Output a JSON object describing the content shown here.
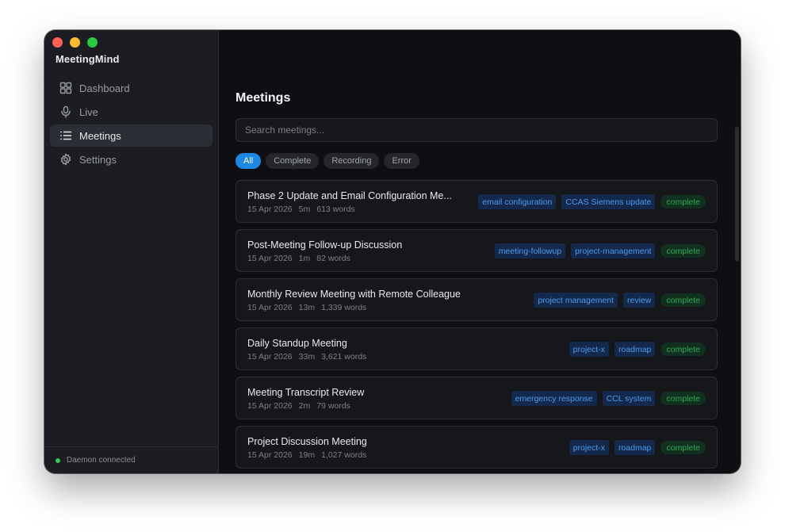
{
  "app": {
    "title": "MeetingMind"
  },
  "sidebar": {
    "items": [
      {
        "label": "Dashboard",
        "icon": "grid-icon"
      },
      {
        "label": "Live",
        "icon": "microphone-icon"
      },
      {
        "label": "Meetings",
        "icon": "list-icon"
      },
      {
        "label": "Settings",
        "icon": "gear-icon"
      }
    ],
    "status": "Daemon connected"
  },
  "main": {
    "title": "Meetings",
    "search": {
      "placeholder": "Search meetings...",
      "value": ""
    },
    "filters": [
      "All",
      "Complete",
      "Recording",
      "Error"
    ],
    "meetings": [
      {
        "title": "Phase 2 Update and Email Configuration Me...",
        "date": "15 Apr 2026",
        "duration": "5m",
        "words": "613 words",
        "tags": [
          "email configuration",
          "CCAS Siemens update"
        ],
        "status": "complete"
      },
      {
        "title": "Post-Meeting Follow-up Discussion",
        "date": "15 Apr 2026",
        "duration": "1m",
        "words": "82 words",
        "tags": [
          "meeting-followup",
          "project-management"
        ],
        "status": "complete"
      },
      {
        "title": "Monthly Review Meeting with Remote Colleague",
        "date": "15 Apr 2026",
        "duration": "13m",
        "words": "1,339 words",
        "tags": [
          "project management",
          "review"
        ],
        "status": "complete"
      },
      {
        "title": "Daily Standup Meeting",
        "date": "15 Apr 2026",
        "duration": "33m",
        "words": "3,621 words",
        "tags": [
          "project-x",
          "roadmap"
        ],
        "status": "complete"
      },
      {
        "title": "Meeting Transcript Review",
        "date": "15 Apr 2026",
        "duration": "2m",
        "words": "79 words",
        "tags": [
          "emergency response",
          "CCL system"
        ],
        "status": "complete"
      },
      {
        "title": "Project Discussion Meeting",
        "date": "15 Apr 2026",
        "duration": "19m",
        "words": "1,027 words",
        "tags": [
          "project-x",
          "roadmap"
        ],
        "status": "complete"
      }
    ]
  },
  "colors": {
    "accent": "#1e88e5",
    "tag_text": "#4d9cf0",
    "complete": "#2fa85a",
    "connected": "#34c759"
  }
}
